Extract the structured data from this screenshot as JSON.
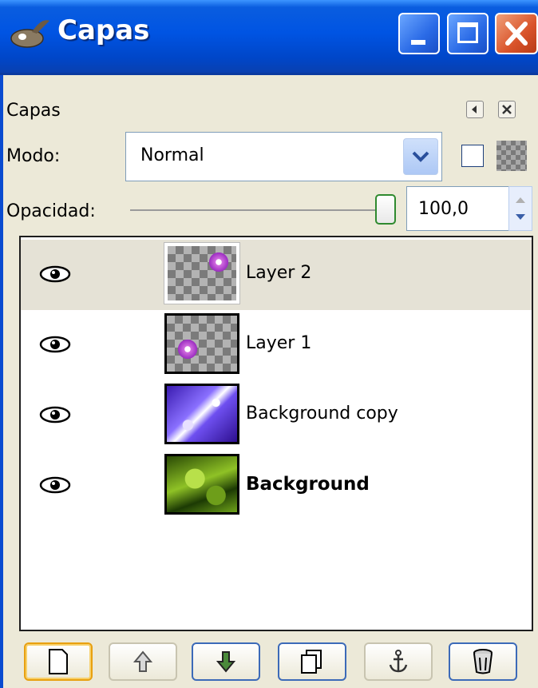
{
  "window": {
    "title": "Capas"
  },
  "panel": {
    "title": "Capas",
    "mode_label": "Modo:",
    "mode_value": "Normal",
    "opacity_label": "Opacidad:",
    "opacity_value": "100,0",
    "opacity_level_percent": 100
  },
  "layers": [
    {
      "name": "Layer 2",
      "visible": true,
      "selected": true,
      "thumbnail": "transparent-with-flower-top-right",
      "bold": false
    },
    {
      "name": "Layer 1",
      "visible": true,
      "selected": false,
      "thumbnail": "transparent-with-flower-bottom-left",
      "bold": false
    },
    {
      "name": "Background copy",
      "visible": true,
      "selected": false,
      "thumbnail": "blue-fern",
      "bold": false
    },
    {
      "name": "Background",
      "visible": true,
      "selected": false,
      "thumbnail": "green-fern",
      "bold": true
    }
  ],
  "toolbar": {
    "buttons": [
      {
        "icon": "new-layer-icon",
        "state": "active"
      },
      {
        "icon": "raise-layer-icon",
        "state": "disabled"
      },
      {
        "icon": "lower-layer-icon",
        "state": "normal"
      },
      {
        "icon": "duplicate-layer-icon",
        "state": "normal"
      },
      {
        "icon": "anchor-icon",
        "state": "disabled"
      },
      {
        "icon": "delete-layer-icon",
        "state": "normal"
      }
    ]
  },
  "colors": {
    "titlebar": "#0054e3",
    "close_button": "#d9532a",
    "selected_row": "#e5e2d6",
    "panel_bg": "#ece9d8"
  }
}
